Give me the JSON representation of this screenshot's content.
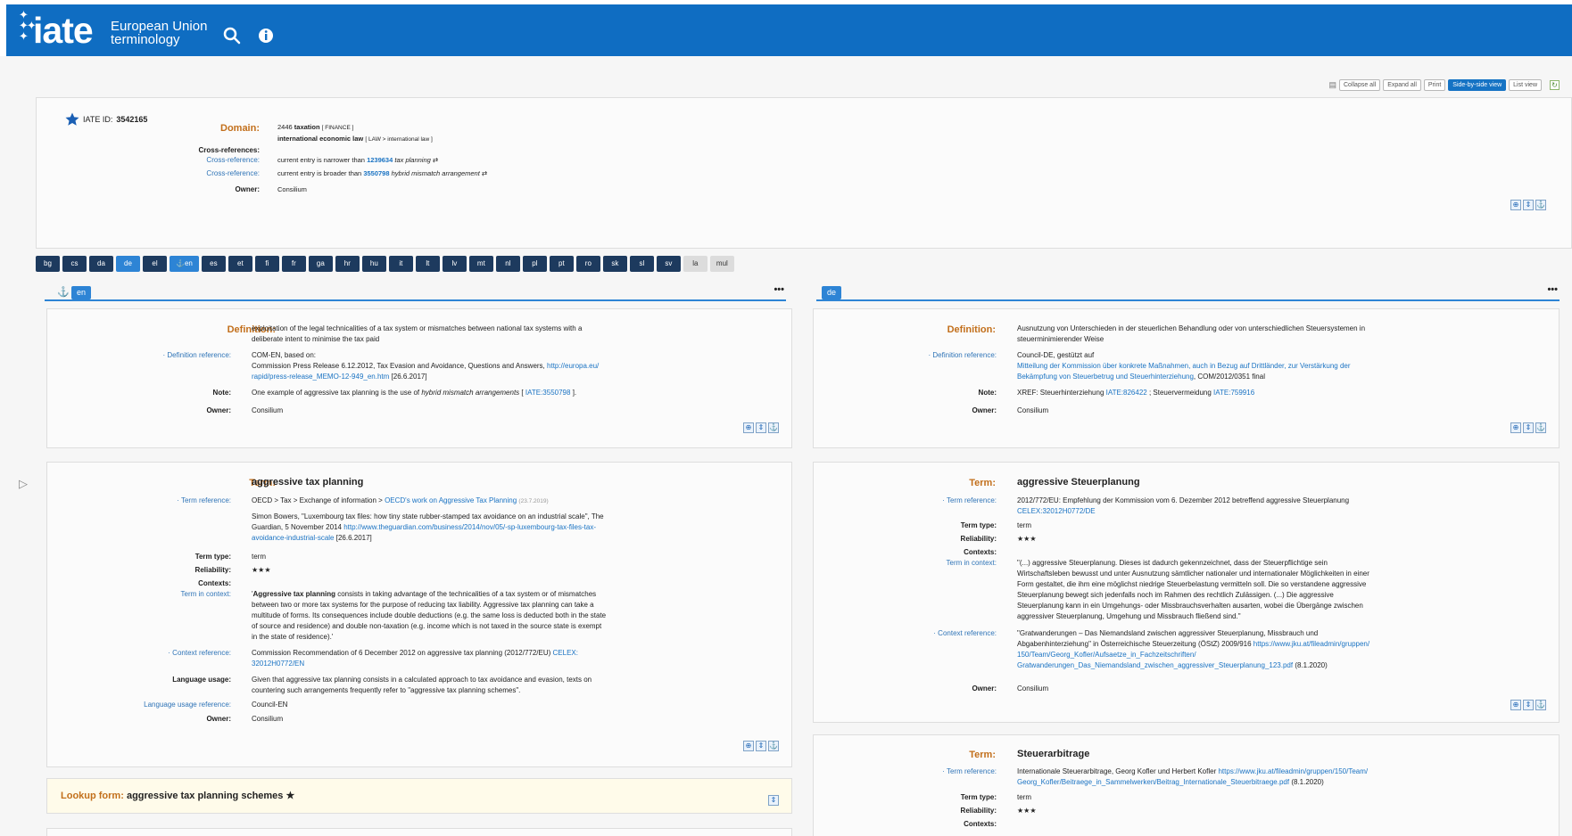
{
  "brand": {
    "name": "iate",
    "sub1": "European Union",
    "sub2": "terminology"
  },
  "toolbar": {
    "collapse": "Collapse all",
    "expand": "Expand all",
    "print": "Print",
    "side": "Side-by-side view",
    "list": "List view"
  },
  "meta": {
    "id_label": "IATE ID:",
    "id_value": "3542165",
    "domain_label": "Domain:",
    "domain1_code": "2446",
    "domain1_name": "taxation",
    "domain1_path": "[ FINANCE ]",
    "domain2_name": "international economic law",
    "domain2_path": "[ LAW > international law ]",
    "cross_label": "Cross-references:",
    "cr_label": "Cross-reference:",
    "cr1_text": "current entry is narrower than",
    "cr1_id": "1239634",
    "cr1_term": "tax planning",
    "cr2_text": "current entry is broader than",
    "cr2_id": "3550798",
    "cr2_term": "hybrid mismatch arrangement",
    "owner_label": "Owner:",
    "owner": "Consilium"
  },
  "languages": [
    "bg",
    "cs",
    "da",
    "de",
    "el",
    "en",
    "es",
    "et",
    "fi",
    "fr",
    "ga",
    "hr",
    "hu",
    "it",
    "lt",
    "lv",
    "mt",
    "nl",
    "pl",
    "pt",
    "ro",
    "sk",
    "sl",
    "sv",
    "la",
    "mul"
  ],
  "en": {
    "tab": "en",
    "def_label": "Definition:",
    "def_line1": "exploitation of the legal technicalities of a tax system or mismatches between national tax systems with a",
    "def_line2": "deliberate intent to minimise the tax paid",
    "defref_label": "· Definition reference:",
    "defref_line1": "COM-EN, based on:",
    "defref_line2": "Commission Press Release 6.12.2012, Tax Evasion and Avoidance, Questions and Answers,",
    "defref_link1": "http://europa.eu/",
    "defref_link2": "rapid/press-release_MEMO-12-949_en.htm",
    "defref_date": "[26.6.2017]",
    "note_label": "Note:",
    "note_pre": "One example of aggressive tax planning is the use of",
    "note_em": "hybrid mismatch arrangements",
    "note_b1": "[",
    "note_link": "IATE:3550798",
    "note_b2": "].",
    "owner_label": "Owner:",
    "owner": "Consilium",
    "term_label": "Term:",
    "term": "aggressive tax planning",
    "termref_label": "· Term reference:",
    "termref_line1": "OECD > Tax > Exchange of information >",
    "termref_link1": "OECD's work on Aggressive Tax Planning",
    "termref_date1": "(23.7.2019)",
    "termref_p2_l1": "Simon Bowers, \"Luxembourg tax files: how tiny state rubber-stamped tax avoidance on an industrial scale\", The",
    "termref_p2_l2": "Guardian, 5 November 2014",
    "termref_p2_link1": "http://www.theguardian.com/business/2014/nov/05/-sp-luxembourg-tax-files-tax-",
    "termref_p2_link2": "avoidance-industrial-scale",
    "termref_p2_date": "[26.6.2017]",
    "ttype_label": "Term type:",
    "ttype": "term",
    "rel_label": "Reliability:",
    "rel": "★★★",
    "contexts_label": "Contexts:",
    "tic_label": "Term in context:",
    "tic_bold": "Aggressive tax planning",
    "tic_l1": "consists in taking advantage of the technicalities of a tax system or of mismatches",
    "tic_l2": "between two or more tax systems for the purpose of reducing tax liability. Aggressive tax planning can take a",
    "tic_l3": "multitude of forms. Its consequences include double deductions (e.g. the same loss is deducted both in the state",
    "tic_l4": "of source and residence) and double non-taxation (e.g. income which is not taxed in the source state is exempt",
    "tic_l5": "in the state of residence).'",
    "ctxref_label": "· Context reference:",
    "ctxref_l1": "Commission Recommendation of 6 December 2012 on aggressive tax planning (2012/772/EU)",
    "ctxref_link1": "CELEX:",
    "ctxref_link2": "32012H0772/EN",
    "lu_label": "Language usage:",
    "lu_l1": "Given that aggressive tax planning consists in a calculated approach to tax avoidance and evasion, texts on",
    "lu_l2": "countering such arrangements frequently refer to \"aggressive tax planning schemes\".",
    "luref_label": "Language usage reference:",
    "luref": "Council-EN",
    "lookup_label": "Lookup form:",
    "lookup_value": "aggressive tax planning schemes ★"
  },
  "de": {
    "tab": "de",
    "def_label": "Definition:",
    "def_line1": "Ausnutzung von Unterschieden in der steuerlichen Behandlung oder von unterschiedlichen Steuersystemen in",
    "def_line2": "steuerminimierender Weise",
    "defref_label": "· Definition reference:",
    "defref_line1": "Council-DE, gestützt auf",
    "defref_link1": "Mitteilung der Kommission über konkrete Maßnahmen, auch in Bezug auf Drittländer, zur Verstärkung der",
    "defref_link2": "Bekämpfung von Steuerbetrug und Steuerhinterziehung",
    "defref_tail": ", COM/2012/0351 final",
    "note_label": "Note:",
    "note_pre": "XREF: Steuerhinterziehung",
    "note_link1": "IATE:826422",
    "note_mid": "; Steuervermeidung",
    "note_link2": "IATE:759916",
    "owner_label": "Owner:",
    "owner": "Consilium",
    "term_label": "Term:",
    "term": "aggressive Steuerplanung",
    "termref_label": "· Term reference:",
    "termref_l1": "2012/772/EU: Empfehlung der Kommission vom 6. Dezember 2012 betreffend aggressive Steuerplanung",
    "termref_link": "CELEX:32012H0772/DE",
    "ttype_label": "Term type:",
    "ttype": "term",
    "rel_label": "Reliability:",
    "rel": "★★★",
    "contexts_label": "Contexts:",
    "tic_label": "Term in context:",
    "tic_l1": "\"(...) aggressive Steuerplanung. Dieses ist dadurch gekennzeichnet, dass der Steuerpflichtige sein",
    "tic_l2": "Wirtschaftsleben bewusst und unter Ausnutzung sämtlicher nationaler und internationaler Möglichkeiten in einer",
    "tic_l3": "Form gestaltet, die ihm eine möglichst niedrige Steuerbelastung vermitteln soll. Die so verstandene aggressive",
    "tic_l4": "Steuerplanung bewegt sich jedenfalls noch im Rahmen des rechtlich Zulässigen. (...) Die aggressive",
    "tic_l5": "Steuerplanung kann in ein Umgehungs- oder Missbrauchsverhalten ausarten, wobei die Übergänge zwischen",
    "tic_l6": "aggressiver Steuerplanung, Umgehung und Missbrauch fließend sind.\"",
    "ctxref_label": "· Context reference:",
    "ctxref_l1": "\"Gratwanderungen – Das Niemandsland zwischen aggressiver Steuerplanung, Missbrauch und",
    "ctxref_l2": "Abgabenhinterziehung\" in Österreichische Steuerzeitung (ÖStZ) 2009/916",
    "ctxref_link1": "https://www.jku.at/fileadmin/gruppen/",
    "ctxref_link2": "150/Team/Georg_Kofler/Aufsaetze_in_Fachzeitschriften/",
    "ctxref_link3": "Gratwanderungen_Das_Niemandsland_zwischen_aggressiver_Steuerplanung_123.pdf",
    "ctxref_date": "(8.1.2020)",
    "term2_label": "Term:",
    "term2": "Steuerarbitrage",
    "termref2_label": "· Term reference:",
    "termref2_l1": "Internationale Steuerarbitrage, Georg Kofler und Herbert Kofler",
    "termref2_link1": "https://www.jku.at/fileadmin/gruppen/150/Team/",
    "termref2_link2": "Georg_Kofler/Beitraege_in_Sammelwerken/Beitrag_Internationale_Steuerbitraege.pdf",
    "termref2_date": "(8.1.2020)",
    "ttype2_label": "Term type:",
    "ttype2": "term",
    "rel2_label": "Reliability:",
    "rel2": "★★★",
    "contexts2_label": "Contexts:"
  },
  "icons": [
    "search-icon",
    "info-icon",
    "star-icon",
    "anchor-icon",
    "refresh-icon",
    "print-icon"
  ],
  "colors": {
    "header": "#0f6dc2",
    "accent": "#2d84d5",
    "label_orange": "#c26f1b",
    "link": "#1a73c3"
  }
}
